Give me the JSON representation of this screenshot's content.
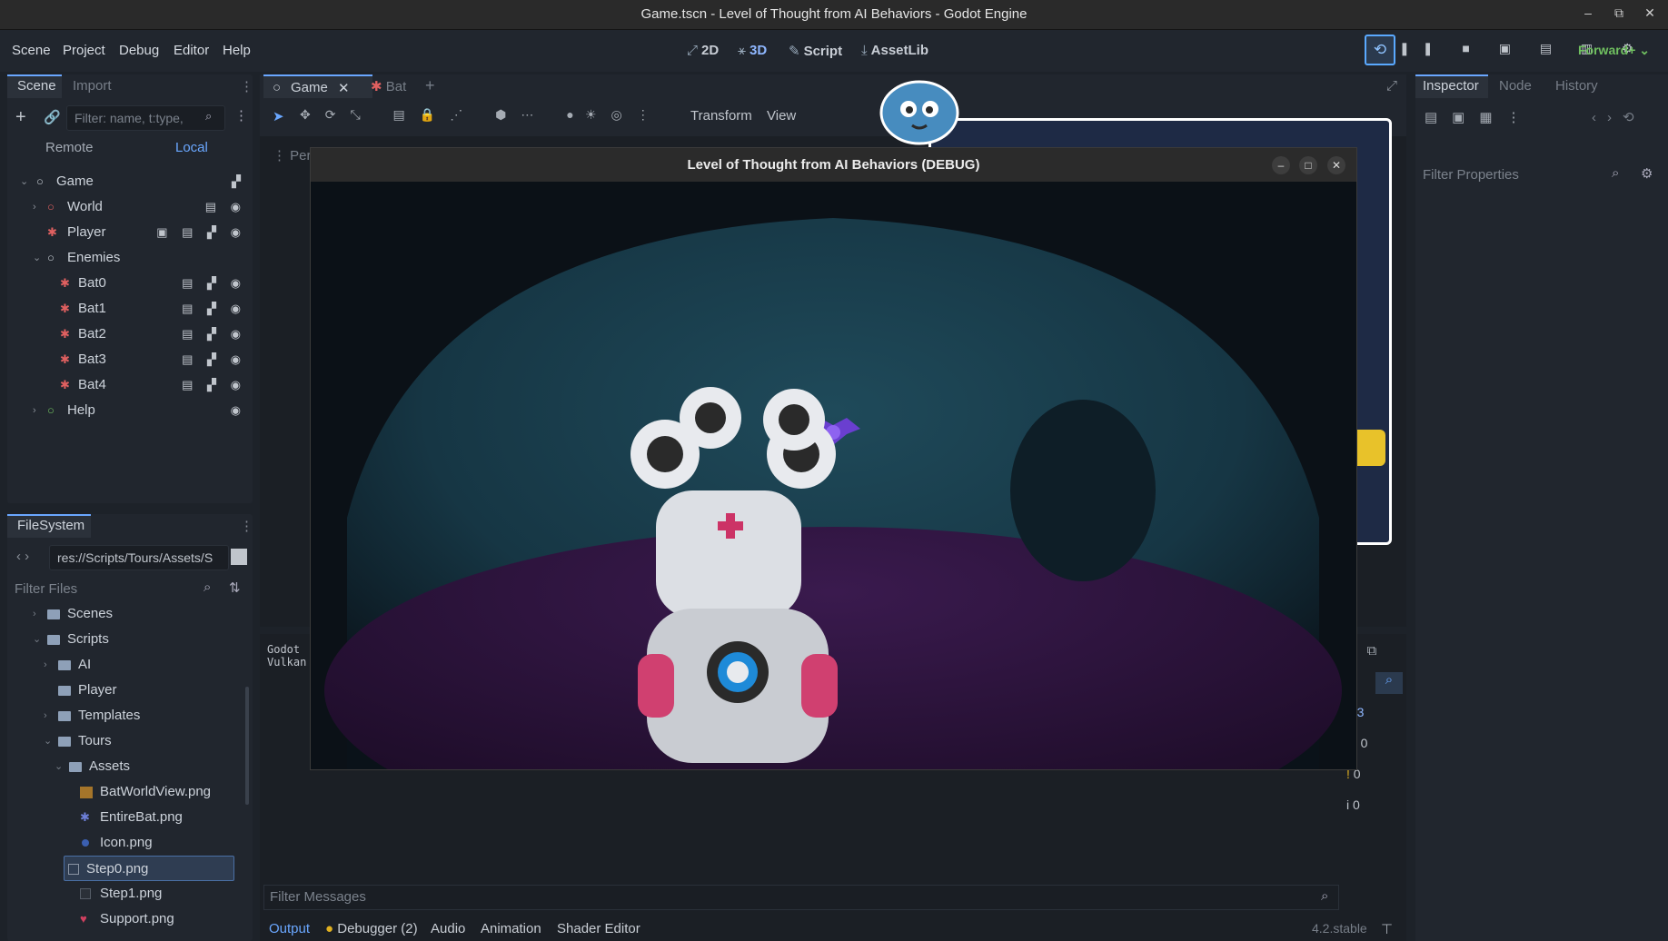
{
  "window": {
    "title": "Game.tscn - Level of Thought from AI Behaviors - Godot Engine"
  },
  "menubar": {
    "menus": [
      "Scene",
      "Project",
      "Debug",
      "Editor",
      "Help"
    ],
    "workspaces": [
      "2D",
      "3D",
      "Script",
      "AssetLib"
    ],
    "renderer": "Forward+"
  },
  "scene_dock": {
    "tabs": [
      "Scene",
      "Import"
    ],
    "filter_placeholder": "Filter: name, t:type,",
    "remote": "Remote",
    "local": "Local",
    "nodes": [
      "Game",
      "World",
      "Player",
      "Enemies",
      "Bat0",
      "Bat1",
      "Bat2",
      "Bat3",
      "Bat4",
      "Help"
    ]
  },
  "filesystem": {
    "tab": "FileSystem",
    "path": "res://Scripts/Tours/Assets/S",
    "filter_placeholder": "Filter Files",
    "items": [
      "Scenes",
      "Scripts",
      "AI",
      "Player",
      "Templates",
      "Tours",
      "Assets",
      "BatWorldView.png",
      "EntireBat.png",
      "Icon.png",
      "Step0.png",
      "Step1.png",
      "Support.png"
    ]
  },
  "editor_tabs": [
    "Game",
    "Bat"
  ],
  "toolbar": {
    "transform": "Transform",
    "view": "View",
    "perspective": "Per"
  },
  "game_window": {
    "title": "Level of Thought from AI Behaviors (DEBUG)"
  },
  "output": {
    "lines": [
      "Godot",
      "Vulkan"
    ],
    "filter_placeholder": "Filter Messages",
    "counts": [
      "3",
      "0",
      "0",
      "0"
    ]
  },
  "bottom_tabs": [
    "Output",
    "Debugger (2)",
    "Audio",
    "Animation",
    "Shader Editor"
  ],
  "version": "4.2.stable",
  "inspector": {
    "tabs": [
      "Inspector",
      "Node",
      "History"
    ],
    "filter_placeholder": "Filter Properties"
  }
}
